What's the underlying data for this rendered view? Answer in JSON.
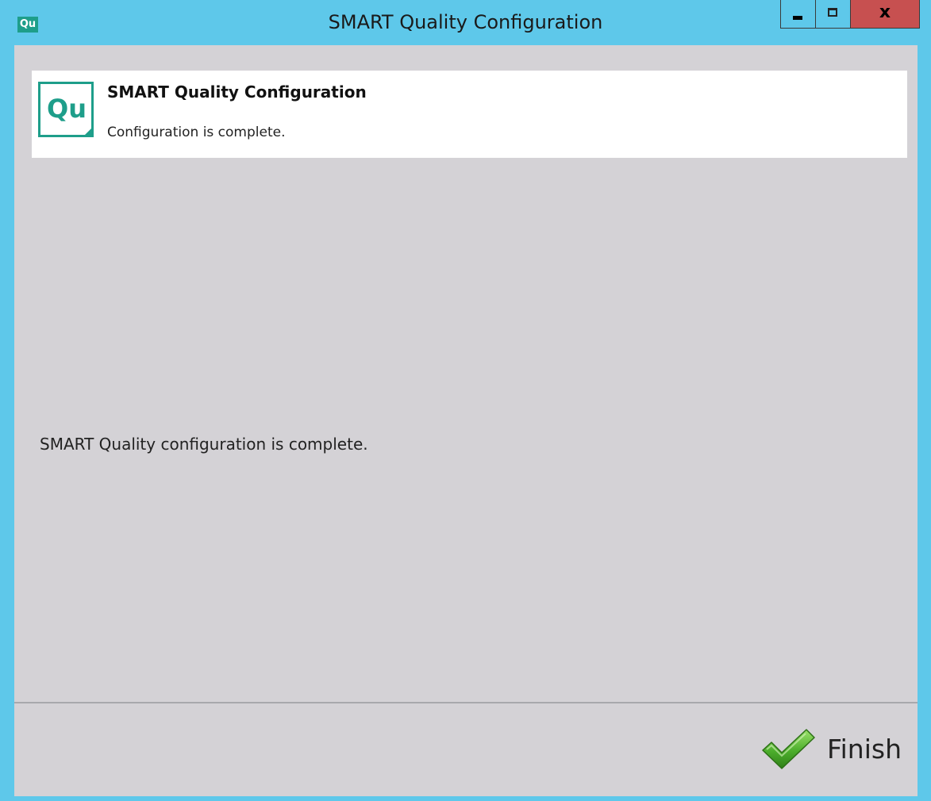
{
  "window": {
    "title": "SMART Quality Configuration",
    "app_icon_text": "Qu",
    "controls": {
      "minimize_icon": "minimize-icon",
      "maximize_icon": "maximize-icon",
      "close_label": "x"
    }
  },
  "header": {
    "logo_text": "Qu",
    "title": "SMART Quality Configuration",
    "subtitle": "Configuration is complete."
  },
  "main": {
    "message": "SMART Quality configuration is complete."
  },
  "footer": {
    "finish_label": "Finish",
    "finish_icon": "checkmark-icon"
  },
  "colors": {
    "titlebar": "#5ec8ea",
    "client_background": "#d4d2d6",
    "brand_teal": "#1e9e8a",
    "close_button": "#c75050",
    "checkmark_green": "#4cae2c"
  }
}
